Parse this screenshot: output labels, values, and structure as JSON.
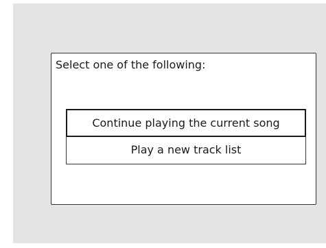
{
  "dialog": {
    "prompt": "Select one of the following:",
    "options": [
      {
        "label": "Continue playing the current song",
        "selected": true
      },
      {
        "label": "Play a new track list",
        "selected": false
      }
    ]
  },
  "colors": {
    "screen_background": "#e4e4e6",
    "dialog_background": "#ffffff",
    "border": "#1a1a1a",
    "text": "#1a1a1a"
  }
}
